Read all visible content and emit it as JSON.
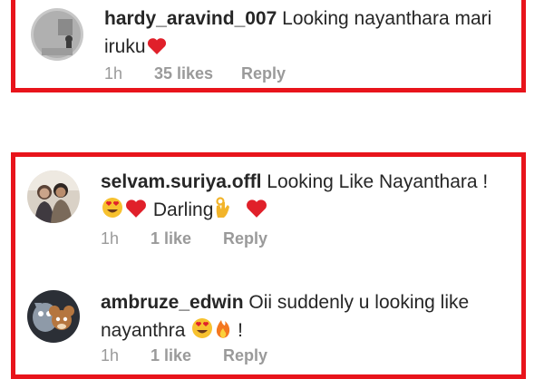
{
  "comments": [
    {
      "username": "hardy_aravind_007",
      "line1": "Looking nayanthara mari",
      "line2": "iruku",
      "time": "1h",
      "likes": "35 likes",
      "reply": "Reply",
      "avatar_icon": "avatar-gray-icon"
    },
    {
      "username": "selvam.suriya.offl",
      "line1": "Looking Like Nayanthara !",
      "line2_text": "Darling",
      "time": "1h",
      "likes": "1 like",
      "reply": "Reply",
      "avatar_icon": "avatar-couple-icon"
    },
    {
      "username": "ambruze_edwin",
      "line1": "Oii suddenly u looking like",
      "line2": "nayanthra",
      "line2_end": "!",
      "time": "1h",
      "likes": "1 like",
      "reply": "Reply",
      "avatar_icon": "avatar-cartoon-icon"
    }
  ],
  "colors": {
    "highlight_border": "#e8141b",
    "meta_text": "#9a9a9a"
  }
}
